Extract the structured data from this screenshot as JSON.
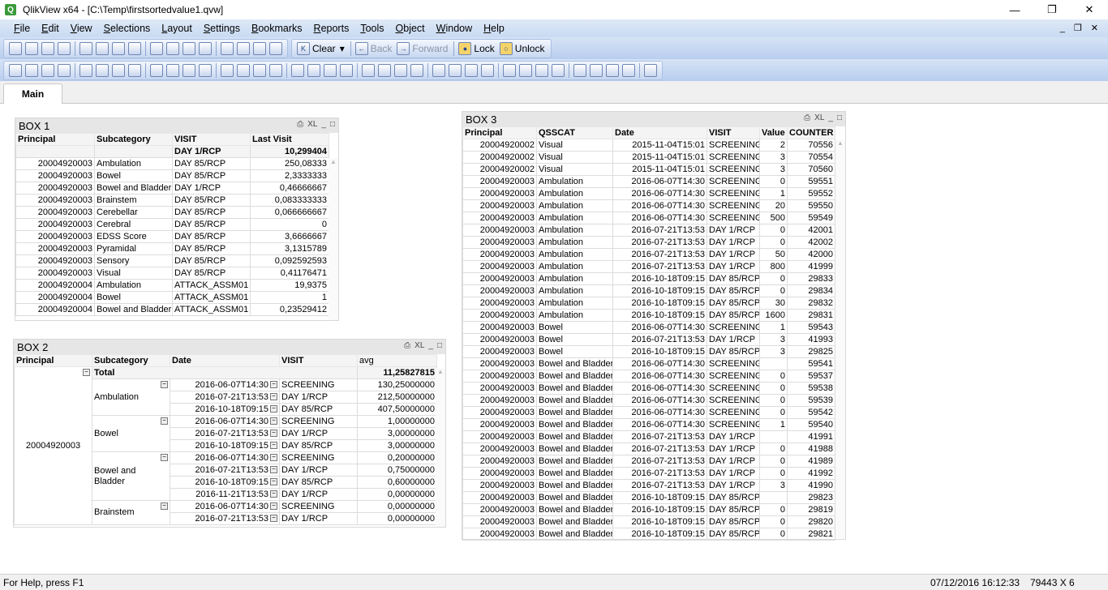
{
  "window": {
    "title": "QlikView x64 - [C:\\Temp\\firstsortedvalue1.qvw]",
    "app_icon": "Q",
    "controls": [
      "minimize-icon",
      "restore-icon",
      "close-icon"
    ]
  },
  "menu": [
    "File",
    "Edit",
    "View",
    "Selections",
    "Layout",
    "Settings",
    "Bookmarks",
    "Reports",
    "Tools",
    "Object",
    "Window",
    "Help"
  ],
  "toolbar1": {
    "icons": [
      "new-icon",
      "open-icon",
      "reload-icon",
      "save-icon",
      "print-icon",
      "edit-script-icon",
      "reload-data-icon",
      "undo-icon",
      "redo-icon",
      "search-icon",
      "selections-icon",
      "chart-icon",
      "bookmark-star-icon",
      "edit-icon",
      "help-icon",
      "context-help-icon"
    ],
    "clear": "Clear",
    "back": "Back",
    "forward": "Forward",
    "lock": "Lock",
    "unlock": "Unlock"
  },
  "toolbar2": {
    "icons": [
      "new-sheet-icon",
      "sheet-back-icon",
      "sheet-forward-icon",
      "sheet-props-icon",
      "listbox-icon",
      "statistics-box-icon",
      "table-box-icon",
      "multibox-icon",
      "chart-object-icon",
      "input-box-icon",
      "current-selections-icon",
      "button-object-icon",
      "text-object-icon",
      "line-arrow-icon",
      "slider-icon",
      "bookmark-object-icon",
      "search-object-icon",
      "container-icon",
      "custom-object-icon",
      "chart-wizard-icon",
      "format-painter-icon",
      "grid-icon",
      "align-left-icon",
      "align-center-icon",
      "align-right-icon",
      "align-bottom-icon",
      "align-middle-icon",
      "align-top-icon",
      "space-vertical-icon",
      "space-horizontal-icon",
      "arrange-icon",
      "align-vertical-icon",
      "user-icon",
      "document-props-icon",
      "sheet-edit-icon",
      "object-tree-icon",
      "document-security-icon"
    ]
  },
  "tabs": [
    {
      "label": "Main",
      "active": true
    }
  ],
  "box1": {
    "title": "BOX 1",
    "headers": [
      "Principal",
      "Subcategory",
      "VISIT",
      "Last Visit"
    ],
    "total": [
      "",
      "",
      "DAY 1/RCP",
      "10,299404"
    ],
    "rows": [
      [
        "20004920003",
        "Ambulation",
        "DAY 85/RCP",
        "250,08333"
      ],
      [
        "20004920003",
        "Bowel",
        "DAY 85/RCP",
        "2,3333333"
      ],
      [
        "20004920003",
        "Bowel and Bladder",
        "DAY 1/RCP",
        "0,46666667"
      ],
      [
        "20004920003",
        "Brainstem",
        "DAY 85/RCP",
        "0,083333333"
      ],
      [
        "20004920003",
        "Cerebellar",
        "DAY 85/RCP",
        "0,066666667"
      ],
      [
        "20004920003",
        "Cerebral",
        "DAY 85/RCP",
        "0"
      ],
      [
        "20004920003",
        "EDSS Score",
        "DAY 85/RCP",
        "3,6666667"
      ],
      [
        "20004920003",
        "Pyramidal",
        "DAY 85/RCP",
        "3,1315789"
      ],
      [
        "20004920003",
        "Sensory",
        "DAY 85/RCP",
        "0,092592593"
      ],
      [
        "20004920003",
        "Visual",
        "DAY 85/RCP",
        "0,41176471"
      ],
      [
        "20004920004",
        "Ambulation",
        "ATTACK_ASSM01",
        "19,9375"
      ],
      [
        "20004920004",
        "Bowel",
        "ATTACK_ASSM01",
        "1"
      ],
      [
        "20004920004",
        "Bowel and Bladder",
        "ATTACK_ASSM01",
        "0,23529412"
      ]
    ]
  },
  "box2": {
    "title": "BOX 2",
    "headers": [
      "Principal",
      "Subcategory",
      "Date",
      "VISIT",
      "avg"
    ],
    "principal": "20004920003",
    "total_label": "Total",
    "total_value": "11,25827815",
    "groups": [
      {
        "subcategory": "Ambulation",
        "rows": [
          [
            "2016-06-07T14:30",
            "SCREENING",
            "130,25000000"
          ],
          [
            "2016-07-21T13:53",
            "DAY 1/RCP",
            "212,50000000"
          ],
          [
            "2016-10-18T09:15",
            "DAY 85/RCP",
            "407,50000000"
          ]
        ]
      },
      {
        "subcategory": "Bowel",
        "rows": [
          [
            "2016-06-07T14:30",
            "SCREENING",
            "1,00000000"
          ],
          [
            "2016-07-21T13:53",
            "DAY 1/RCP",
            "3,00000000"
          ],
          [
            "2016-10-18T09:15",
            "DAY 85/RCP",
            "3,00000000"
          ]
        ]
      },
      {
        "subcategory": "Bowel and Bladder",
        "rows": [
          [
            "2016-06-07T14:30",
            "SCREENING",
            "0,20000000"
          ],
          [
            "2016-07-21T13:53",
            "DAY 1/RCP",
            "0,75000000"
          ],
          [
            "2016-10-18T09:15",
            "DAY 85/RCP",
            "0,60000000"
          ],
          [
            "2016-11-21T13:53",
            "DAY 1/RCP",
            "0,00000000"
          ]
        ]
      },
      {
        "subcategory": "Brainstem",
        "rows": [
          [
            "2016-06-07T14:30",
            "SCREENING",
            "0,00000000"
          ],
          [
            "2016-07-21T13:53",
            "DAY 1/RCP",
            "0,00000000"
          ]
        ]
      }
    ]
  },
  "box3": {
    "title": "BOX 3",
    "headers": [
      "Principal",
      "QSSCAT",
      "Date",
      "VISIT",
      "Value",
      "COUNTER"
    ],
    "rows": [
      [
        "20004920002",
        "Visual",
        "2015-11-04T15:01",
        "SCREENING",
        "2",
        "70556"
      ],
      [
        "20004920002",
        "Visual",
        "2015-11-04T15:01",
        "SCREENING",
        "3",
        "70554"
      ],
      [
        "20004920002",
        "Visual",
        "2015-11-04T15:01",
        "SCREENING",
        "3",
        "70560"
      ],
      [
        "20004920003",
        "Ambulation",
        "2016-06-07T14:30",
        "SCREENING",
        "0",
        "59551"
      ],
      [
        "20004920003",
        "Ambulation",
        "2016-06-07T14:30",
        "SCREENING",
        "1",
        "59552"
      ],
      [
        "20004920003",
        "Ambulation",
        "2016-06-07T14:30",
        "SCREENING",
        "20",
        "59550"
      ],
      [
        "20004920003",
        "Ambulation",
        "2016-06-07T14:30",
        "SCREENING",
        "500",
        "59549"
      ],
      [
        "20004920003",
        "Ambulation",
        "2016-07-21T13:53",
        "DAY 1/RCP",
        "0",
        "42001"
      ],
      [
        "20004920003",
        "Ambulation",
        "2016-07-21T13:53",
        "DAY 1/RCP",
        "0",
        "42002"
      ],
      [
        "20004920003",
        "Ambulation",
        "2016-07-21T13:53",
        "DAY 1/RCP",
        "50",
        "42000"
      ],
      [
        "20004920003",
        "Ambulation",
        "2016-07-21T13:53",
        "DAY 1/RCP",
        "800",
        "41999"
      ],
      [
        "20004920003",
        "Ambulation",
        "2016-10-18T09:15",
        "DAY 85/RCP",
        "0",
        "29833"
      ],
      [
        "20004920003",
        "Ambulation",
        "2016-10-18T09:15",
        "DAY 85/RCP",
        "0",
        "29834"
      ],
      [
        "20004920003",
        "Ambulation",
        "2016-10-18T09:15",
        "DAY 85/RCP",
        "30",
        "29832"
      ],
      [
        "20004920003",
        "Ambulation",
        "2016-10-18T09:15",
        "DAY 85/RCP",
        "1600",
        "29831"
      ],
      [
        "20004920003",
        "Bowel",
        "2016-06-07T14:30",
        "SCREENING",
        "1",
        "59543"
      ],
      [
        "20004920003",
        "Bowel",
        "2016-07-21T13:53",
        "DAY 1/RCP",
        "3",
        "41993"
      ],
      [
        "20004920003",
        "Bowel",
        "2016-10-18T09:15",
        "DAY 85/RCP",
        "3",
        "29825"
      ],
      [
        "20004920003",
        "Bowel and Bladder",
        "2016-06-07T14:30",
        "SCREENING",
        "",
        "59541"
      ],
      [
        "20004920003",
        "Bowel and Bladder",
        "2016-06-07T14:30",
        "SCREENING",
        "0",
        "59537"
      ],
      [
        "20004920003",
        "Bowel and Bladder",
        "2016-06-07T14:30",
        "SCREENING",
        "0",
        "59538"
      ],
      [
        "20004920003",
        "Bowel and Bladder",
        "2016-06-07T14:30",
        "SCREENING",
        "0",
        "59539"
      ],
      [
        "20004920003",
        "Bowel and Bladder",
        "2016-06-07T14:30",
        "SCREENING",
        "0",
        "59542"
      ],
      [
        "20004920003",
        "Bowel and Bladder",
        "2016-06-07T14:30",
        "SCREENING",
        "1",
        "59540"
      ],
      [
        "20004920003",
        "Bowel and Bladder",
        "2016-07-21T13:53",
        "DAY 1/RCP",
        "",
        "41991"
      ],
      [
        "20004920003",
        "Bowel and Bladder",
        "2016-07-21T13:53",
        "DAY 1/RCP",
        "0",
        "41988"
      ],
      [
        "20004920003",
        "Bowel and Bladder",
        "2016-07-21T13:53",
        "DAY 1/RCP",
        "0",
        "41989"
      ],
      [
        "20004920003",
        "Bowel and Bladder",
        "2016-07-21T13:53",
        "DAY 1/RCP",
        "0",
        "41992"
      ],
      [
        "20004920003",
        "Bowel and Bladder",
        "2016-07-21T13:53",
        "DAY 1/RCP",
        "3",
        "41990"
      ],
      [
        "20004920003",
        "Bowel and Bladder",
        "2016-10-18T09:15",
        "DAY 85/RCP",
        "",
        "29823"
      ],
      [
        "20004920003",
        "Bowel and Bladder",
        "2016-10-18T09:15",
        "DAY 85/RCP",
        "0",
        "29819"
      ],
      [
        "20004920003",
        "Bowel and Bladder",
        "2016-10-18T09:15",
        "DAY 85/RCP",
        "0",
        "29820"
      ],
      [
        "20004920003",
        "Bowel and Bladder",
        "2016-10-18T09:15",
        "DAY 85/RCP",
        "0",
        "29821"
      ]
    ]
  },
  "caption_icons": {
    "print": "⎙",
    "xl": "XL",
    "minimize": "_",
    "maximize": "□"
  },
  "status": {
    "help": "For Help, press F1",
    "datetime": "07/12/2016 16:12:33",
    "dimensions": "79443 X 6"
  }
}
